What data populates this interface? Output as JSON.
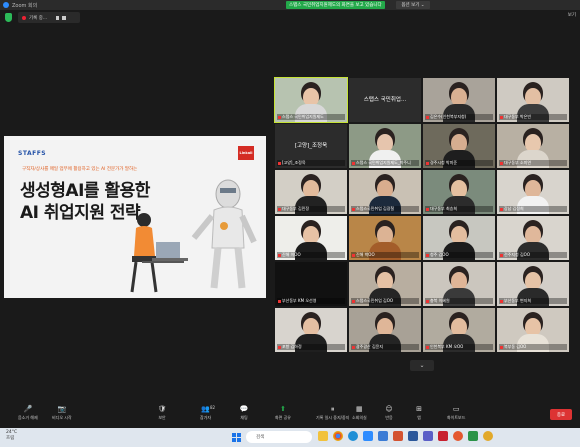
{
  "window": {
    "title": "Zoom 회의"
  },
  "share_banner": {
    "text": "스탭스 국민취업지원제도의 화면을 보고 있습니다",
    "view_options": "옵션 보기 ⌄"
  },
  "recording": {
    "label": "기록 중..."
  },
  "top_right": {
    "view": "보기"
  },
  "slide": {
    "brand": "STAFFS",
    "badge": "Linkall",
    "subtitle": "구직자/상사를 매일 업무에 활용하고 있는 AI 전문가가 말하는",
    "title_line1": "생성형AI를 활용한",
    "title_line2": "AI 취업지원 전략"
  },
  "participants": [
    {
      "name": "스탭스 국민취업지원제도",
      "kind": "video",
      "active": true,
      "skin": "#e8c4a8",
      "shirt": "#d8d8d8",
      "bg": "#b7c3b0"
    },
    {
      "name": "스탭스 국민취업...",
      "sub": "",
      "kind": "text"
    },
    {
      "name": "김은수(인천북부지청)",
      "kind": "video",
      "skin": "#d9b092",
      "shirt": "#2a2a2a",
      "bg": "#a9a39a"
    },
    {
      "name": "대구동부 박은빈",
      "kind": "video",
      "skin": "#e3bfa3",
      "shirt": "#3c3c3c",
      "bg": "#cfcac2"
    },
    {
      "name": "[고양]_조정욱",
      "kind": "text",
      "label": "[고양]_조정욱"
    },
    {
      "name": "스탭스 국민취업지원제도_박주니",
      "kind": "video",
      "skin": "#e6c5ad",
      "shirt": "#f0f0f0",
      "bg": "#8d9a86"
    },
    {
      "name": "경주시청 박미준",
      "kind": "video",
      "skin": "#d6ad90",
      "shirt": "#1e1e1e",
      "bg": "#6e6a5c"
    },
    {
      "name": "대구동부 소미연",
      "kind": "video",
      "skin": "#e8c8ae",
      "shirt": "#dcd6cc",
      "bg": "#b8b0a3"
    },
    {
      "name": "대구동부 김민정",
      "kind": "video",
      "skin": "#e2bb9c",
      "shirt": "#222222",
      "bg": "#d3cfc6"
    },
    {
      "name": "스탭스국민취업 김광철",
      "kind": "video",
      "skin": "#d8ad8e",
      "shirt": "#1c2a3c",
      "bg": "#c9c1b4"
    },
    {
      "name": "대구동부 최승희",
      "kind": "video",
      "skin": "#e5c0a0",
      "shirt": "#2c2c2c",
      "bg": "#7b8b7c"
    },
    {
      "name": "강남 김정희",
      "kind": "video",
      "skin": "#dfb79a",
      "shirt": "#f2f2f2",
      "bg": "#d8d4cd"
    },
    {
      "name": "진해 이OO",
      "kind": "video",
      "skin": "#e7c2a5",
      "shirt": "#1d1d1d",
      "bg": "#eeeeea"
    },
    {
      "name": "진해 박OO",
      "kind": "video",
      "skin": "#dcb394",
      "shirt": "#a35d2a",
      "bg": "#b98648"
    },
    {
      "name": "청주 김OO",
      "kind": "video",
      "skin": "#e3bd9f",
      "shirt": "#1c1c1c",
      "bg": "#c7c7c0"
    },
    {
      "name": "전주지청 김OO",
      "kind": "video",
      "skin": "#e0b89b",
      "shirt": "#2c2c2c",
      "bg": "#d9d5ce"
    },
    {
      "name": "부산동부 KM 오선영",
      "kind": "dark"
    },
    {
      "name": "스탭스국민취업 김OO",
      "kind": "video",
      "skin": "#e5c1a4",
      "shirt": "#252525",
      "bg": "#b8aea0"
    },
    {
      "name": "충북 이혜원",
      "kind": "video",
      "skin": "#dfb597",
      "shirt": "#3a3a3a",
      "bg": "#cbc6be"
    },
    {
      "name": "부산동부 변지희",
      "kind": "video",
      "skin": "#e6c3a6",
      "shirt": "#2a2a2a",
      "bg": "#d2cec8"
    },
    {
      "name": "포항 김하정",
      "kind": "video",
      "skin": "#e4bfa2",
      "shirt": "#1f1f1f",
      "bg": "#d8d4ce"
    },
    {
      "name": "광주광산 김윤지",
      "kind": "video",
      "skin": "#dfb698",
      "shirt": "#242424",
      "bg": "#a8a196"
    },
    {
      "name": "인천북부 KM 오OO",
      "kind": "video",
      "skin": "#e2bc9e",
      "shirt": "#2b2b2b",
      "bg": "#b1ab9f"
    },
    {
      "name": "북부동 김OO",
      "kind": "video",
      "skin": "#e7c3a6",
      "shirt": "#e8e2d8",
      "bg": "#cfc9c0"
    }
  ],
  "toolbar": {
    "items": [
      {
        "label": "음소거 해제",
        "icon": "mic-muted-icon"
      },
      {
        "label": "비디오 시작",
        "icon": "video-off-icon"
      },
      {
        "label": "보안",
        "icon": "shield-icon"
      },
      {
        "label": "참가자",
        "icon": "participants-icon",
        "count": "82"
      },
      {
        "label": "채팅",
        "icon": "chat-icon"
      },
      {
        "label": "화면 공유",
        "icon": "share-screen-icon"
      },
      {
        "label": "기록 일시 중지/중지",
        "icon": "pause-record-icon"
      },
      {
        "label": "소회의실",
        "icon": "breakout-icon"
      },
      {
        "label": "반응",
        "icon": "reaction-icon"
      },
      {
        "label": "앱",
        "icon": "apps-icon"
      },
      {
        "label": "화이트보드",
        "icon": "whiteboard-icon"
      }
    ],
    "end_label": "종료"
  },
  "taskbar": {
    "weather_temp": "24°C",
    "weather_text": "흐림",
    "search_placeholder": "검색"
  },
  "colors": {
    "share_green": "#23a94a",
    "active_border": "#c6e336",
    "end_red": "#d33",
    "slide_title_orange": "#e05a1a"
  }
}
